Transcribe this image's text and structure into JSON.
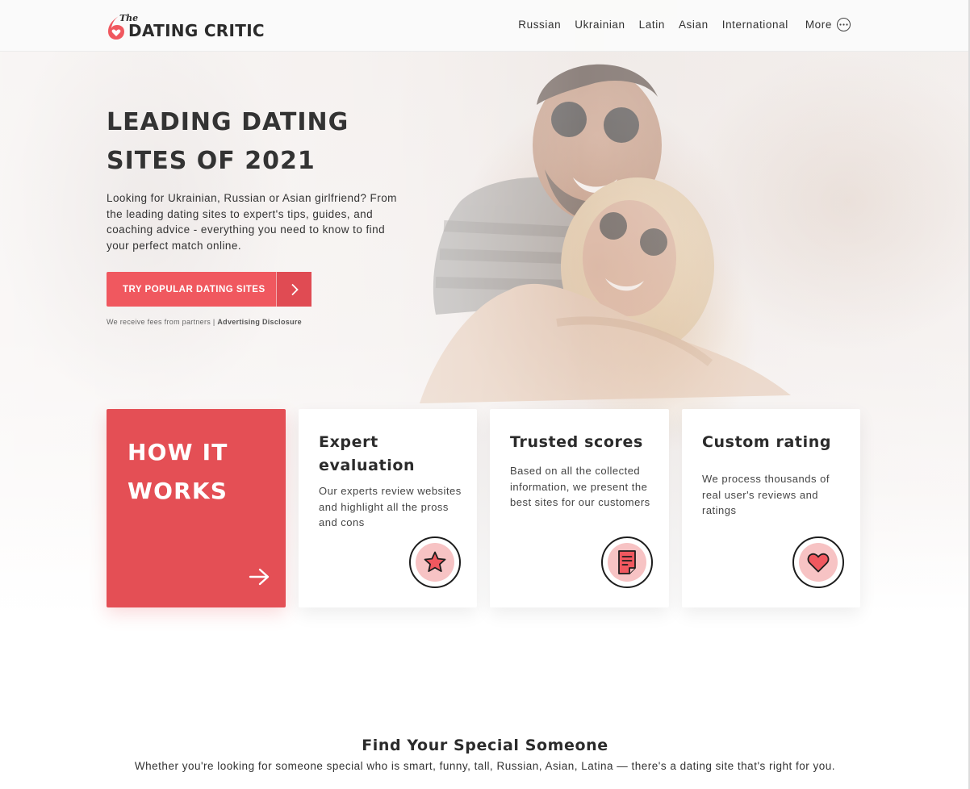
{
  "header": {
    "logo_the": "The",
    "logo_text": "DATING CRITIC",
    "nav": [
      "Russian",
      "Ukrainian",
      "Latin",
      "Asian",
      "International"
    ],
    "more_label": "More"
  },
  "hero": {
    "title_line1": "LEADING DATING",
    "title_line2": "SITES OF 2021",
    "description": "Looking for Ukrainian, Russian or Asian girlfriend? From the leading dating sites to expert's tips, guides, and coaching advice - everything you need to know to find your perfect match online.",
    "cta_label": "TRY POPULAR DATING SITES",
    "disclosure_text": "We receive fees from partners |",
    "disclosure_link": "Advertising Disclosure"
  },
  "how_it_works": {
    "title_line1": "HOW IT",
    "title_line2": "WORKS",
    "cards": [
      {
        "title": "Expert evaluation",
        "text": "Our experts review websites and highlight all the pross and cons",
        "icon": "star-icon"
      },
      {
        "title": "Trusted scores",
        "text": "Based on all the collected information, we present the best sites for our customers",
        "icon": "document-icon"
      },
      {
        "title": "Custom rating",
        "text": "We process thousands of real user's reviews and ratings",
        "icon": "heart-icon"
      }
    ]
  },
  "find": {
    "title": "Find Your Special Someone",
    "subtitle": "Whether you're looking for someone special who is smart, funny, tall, Russian, Asian, Latina — there's a dating site that's right for you."
  },
  "colors": {
    "accent": "#f0585f",
    "accent_dark": "#e44f55",
    "icon_fill": "#f7c3c4"
  }
}
